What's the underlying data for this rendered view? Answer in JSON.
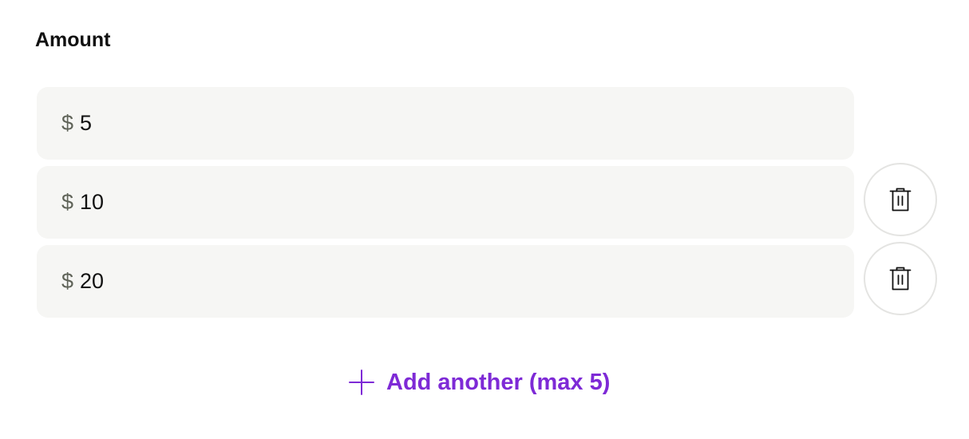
{
  "form": {
    "label": "Amount",
    "currency_symbol": "$",
    "amounts": [
      {
        "value": "5",
        "deletable": false
      },
      {
        "value": "10",
        "deletable": true
      },
      {
        "value": "20",
        "deletable": true
      }
    ],
    "delete_icon": "trash-icon",
    "add_button": {
      "icon": "plus-icon",
      "label": "Add another (max 5)"
    }
  },
  "colors": {
    "accent": "#7e2ad6",
    "field_background": "#f6f6f4",
    "border": "#e4e4e2"
  }
}
